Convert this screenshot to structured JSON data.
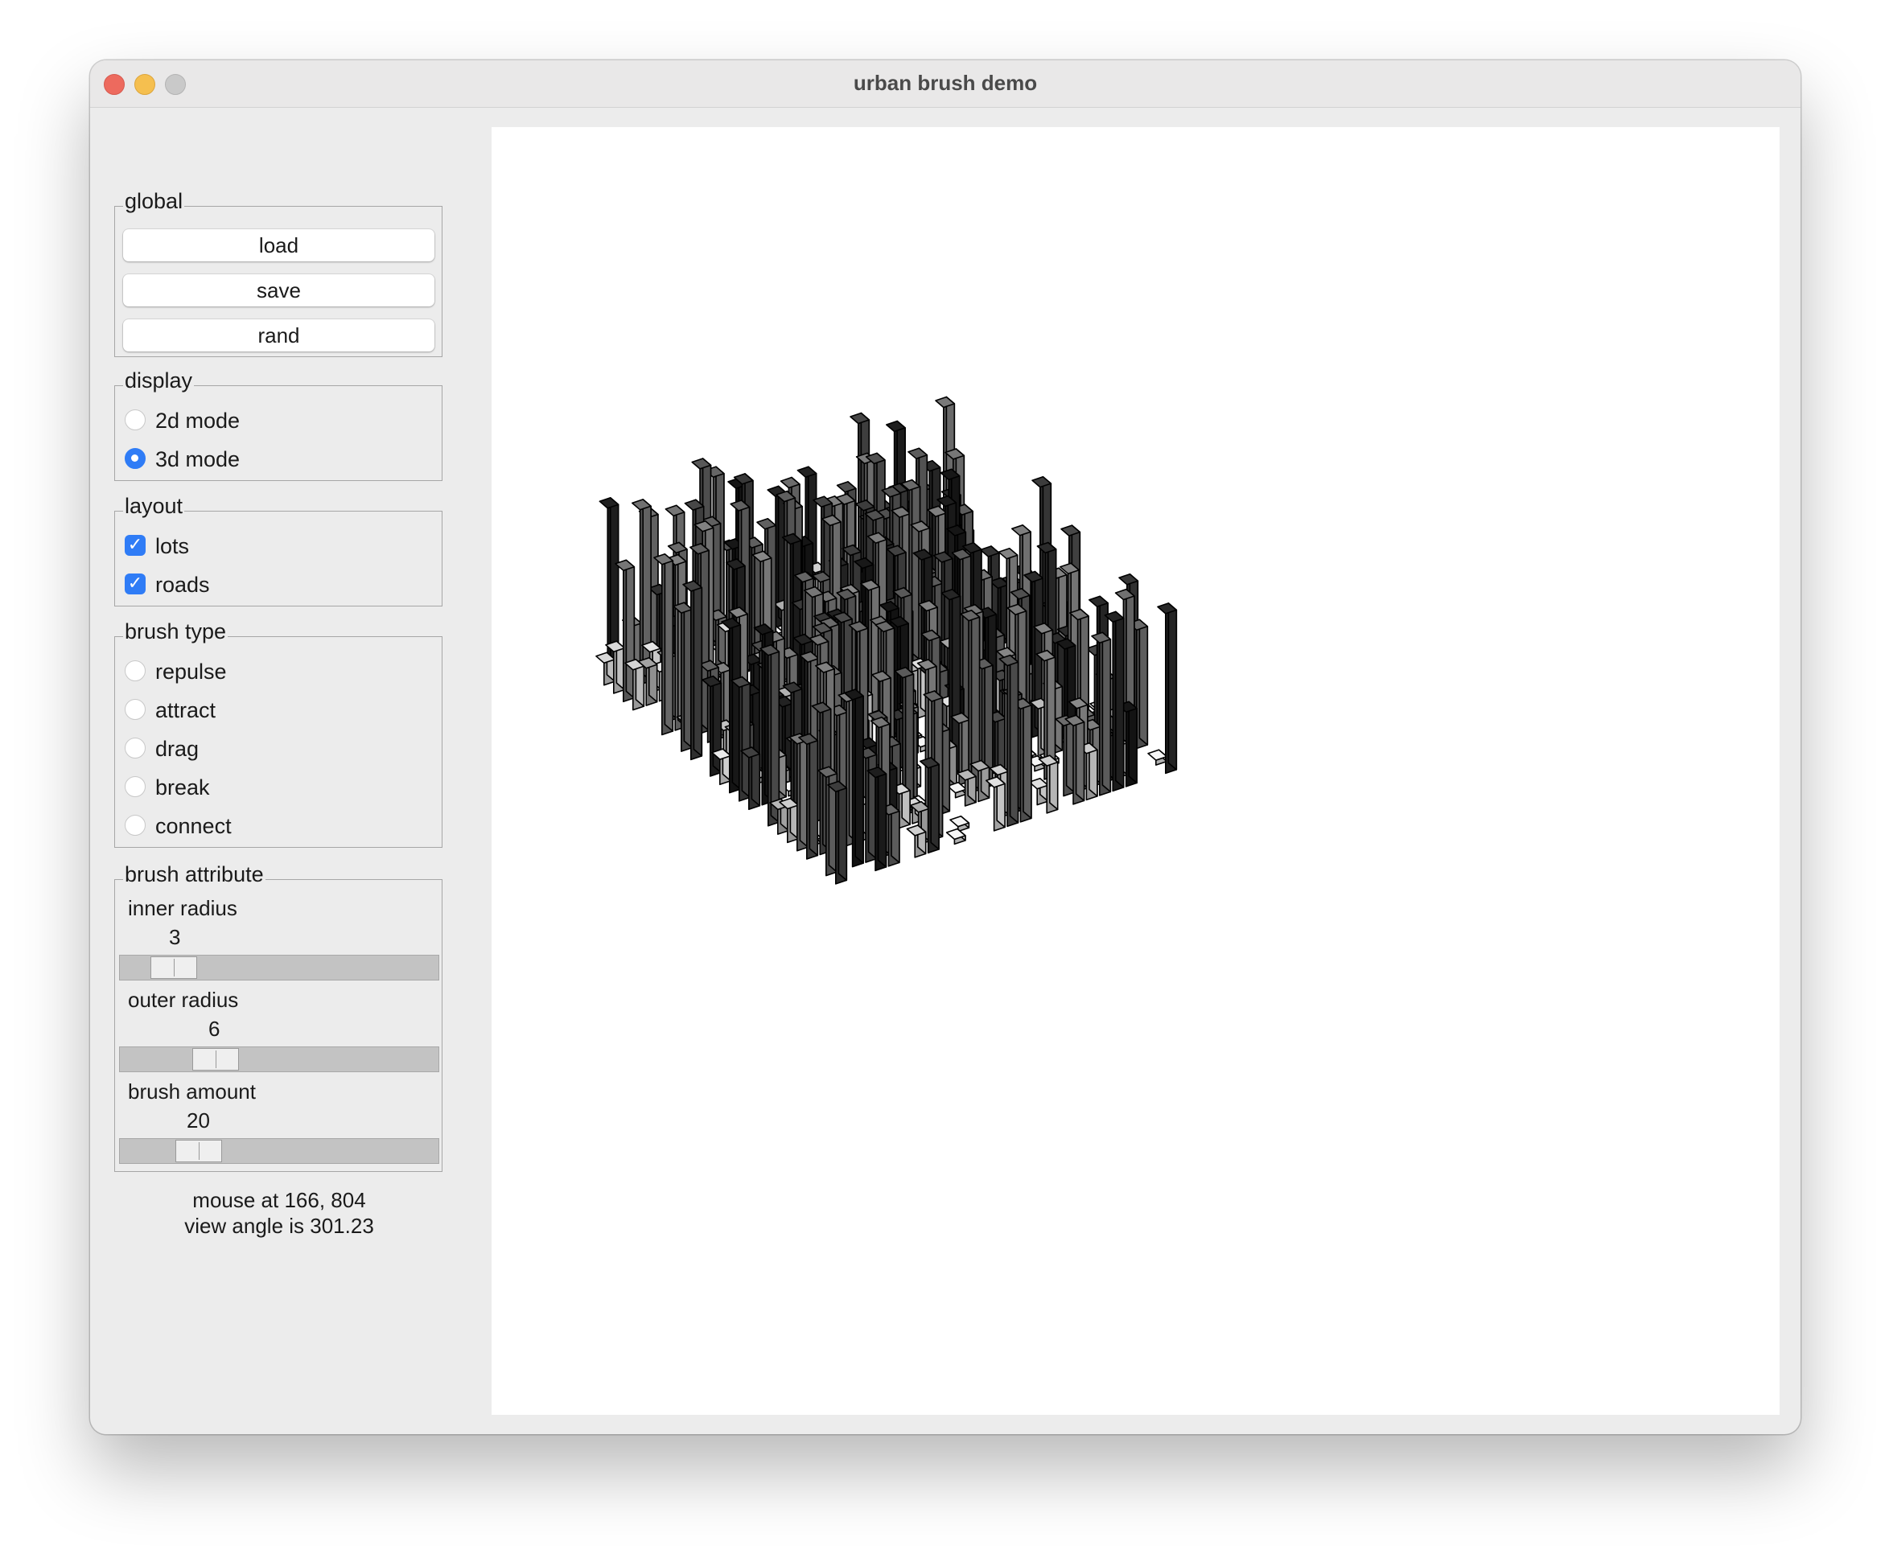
{
  "window": {
    "title": "urban brush demo"
  },
  "global": {
    "label": "global",
    "buttons": [
      "load",
      "save",
      "rand"
    ]
  },
  "display": {
    "label": "display",
    "options": [
      {
        "label": "2d mode",
        "selected": false
      },
      {
        "label": "3d mode",
        "selected": true
      }
    ]
  },
  "layout": {
    "label": "layout",
    "options": [
      {
        "label": "lots",
        "checked": true
      },
      {
        "label": "roads",
        "checked": true
      }
    ]
  },
  "brush_type": {
    "label": "brush type",
    "options": [
      {
        "label": "repulse",
        "selected": false
      },
      {
        "label": "attract",
        "selected": false
      },
      {
        "label": "drag",
        "selected": false
      },
      {
        "label": "break",
        "selected": false
      },
      {
        "label": "connect",
        "selected": false
      }
    ]
  },
  "brush_attribute": {
    "label": "brush attribute",
    "inner_radius": {
      "label": "inner radius",
      "value": "3"
    },
    "outer_radius": {
      "label": "outer radius",
      "value": "6"
    },
    "brush_amount": {
      "label": "brush amount",
      "value": "20"
    }
  },
  "status": {
    "mouse": "mouse at 166, 804",
    "view_angle": "view angle is 301.23"
  },
  "colors": {
    "accent": "#2f7cf6",
    "close": "#ed6a5e",
    "minimize": "#f5bf4f",
    "maximize": "#c9c9c9"
  }
}
